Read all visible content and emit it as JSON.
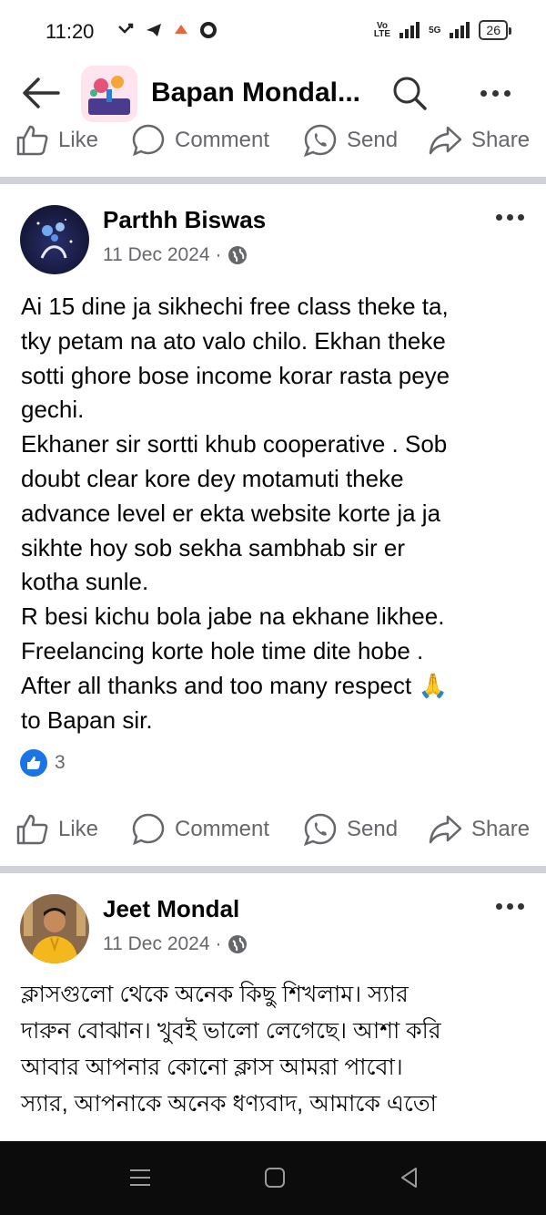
{
  "status": {
    "time": "11:20",
    "net_label_top": "Vo",
    "net_label_bottom": "LTE",
    "net_5g": "5G",
    "battery": "26"
  },
  "app_bar": {
    "title": "Bapan Mondal..."
  },
  "actions": {
    "like": "Like",
    "comment": "Comment",
    "send": "Send",
    "share": "Share"
  },
  "posts": [
    {
      "author": "Parthh Biswas",
      "date": "11 Dec 2024",
      "separator": "·",
      "lines": [
        "Ai 15 dine ja sikhechi free class theke ta,",
        "tky petam na ato valo chilo. Ekhan theke",
        "sotti ghore bose income korar rasta peye",
        "gechi.",
        "Ekhaner sir sortti khub cooperative . Sob",
        "doubt clear kore dey motamuti theke",
        "advance level er ekta website korte ja ja",
        "sikhte hoy sob sekha sambhab sir er",
        "kotha sunle.",
        "R besi kichu bola jabe na ekhane likhee.",
        "Freelancing korte hole time dite hobe .",
        "After all thanks and too many respect 🙏",
        "to Bapan sir."
      ],
      "reaction_count": "3"
    },
    {
      "author": "Jeet Mondal",
      "date": "11 Dec 2024",
      "separator": "·",
      "lines": [
        "ক্লাসগুলো থেকে অনেক কিছু শিখলাম। স্যার",
        "দারুন বোঝান। খুবই ভালো লেগেছে। আশা করি",
        "আবার আপনার কোনো ক্লাস আমরা পাবো।",
        "স্যার, আপনাকে অনেক ধণ্যবাদ, আমাকে এতো"
      ]
    }
  ],
  "icons": {
    "back": "arrow-left-icon",
    "search": "search-icon",
    "more": "more-dots-icon",
    "like": "thumbs-up-icon",
    "comment": "comment-bubble-icon",
    "send": "whatsapp-icon",
    "share": "share-arrow-icon",
    "globe": "globe-icon"
  },
  "colors": {
    "accent": "#1b74e4",
    "secondary_text": "#65676b",
    "divider": "#cfd3d8",
    "nav_bar": "#0c0c0c"
  }
}
